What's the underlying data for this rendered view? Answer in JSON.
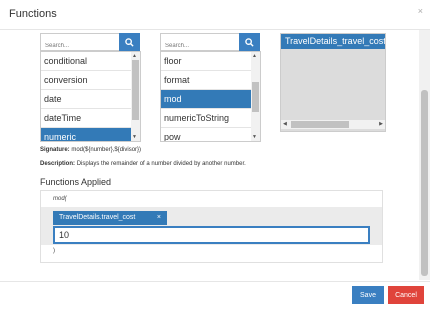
{
  "dialog": {
    "title": "Functions",
    "close_symbol": "×"
  },
  "left_panel": {
    "search_placeholder": "Search...",
    "items": [
      {
        "label": "conditional"
      },
      {
        "label": "conversion"
      },
      {
        "label": "date"
      },
      {
        "label": "dateTime"
      },
      {
        "label": "numeric",
        "selected": true
      }
    ]
  },
  "middle_panel": {
    "search_placeholder": "Search...",
    "items": [
      {
        "label": "floor"
      },
      {
        "label": "format"
      },
      {
        "label": "mod",
        "selected": true
      },
      {
        "label": "numericToString"
      },
      {
        "label": "pow"
      }
    ]
  },
  "preview_panel": {
    "header": "TravelDetails_travel_cost"
  },
  "signature": {
    "label": "Signature:",
    "value": "mod(${number},${divisor})"
  },
  "description": {
    "label": "Description:",
    "value": "Displays the remainder of a number divided by another number."
  },
  "functions_applied": {
    "title": "Functions Applied",
    "function_name": "mod(",
    "chip_label": "TravelDetails.travel_cost",
    "chip_close": "×",
    "value": "10",
    "closing": ")"
  },
  "footer": {
    "save_label": "Save",
    "cancel_label": "Cancel"
  },
  "colors": {
    "accent": "#337ab7",
    "cancel": "#e0443b"
  }
}
